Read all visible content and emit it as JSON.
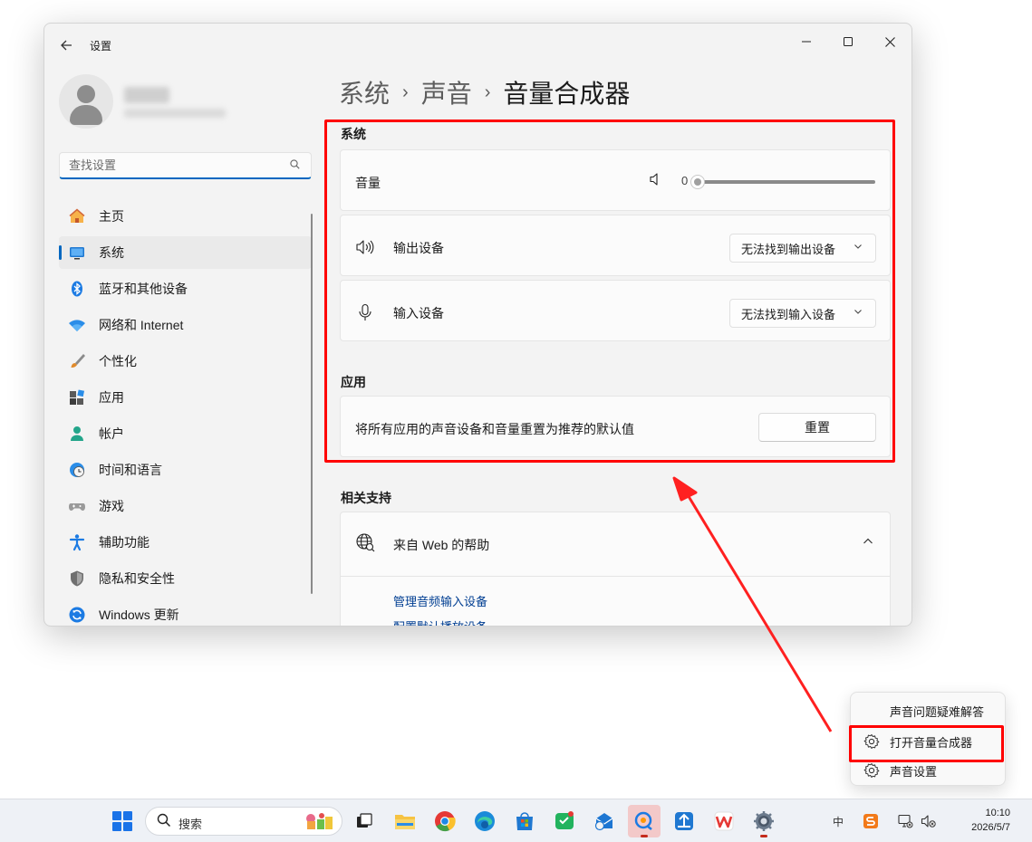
{
  "window": {
    "app_title": "设置",
    "controls": {
      "minimize": "—",
      "maximize": "☐",
      "close": "✕"
    }
  },
  "sidebar": {
    "search_placeholder": "查找设置",
    "items": [
      {
        "label": "主页",
        "icon": "home-icon"
      },
      {
        "label": "系统",
        "icon": "system-display-icon",
        "active": true
      },
      {
        "label": "蓝牙和其他设备",
        "icon": "bluetooth-icon"
      },
      {
        "label": "网络和 Internet",
        "icon": "wifi-icon"
      },
      {
        "label": "个性化",
        "icon": "brush-icon"
      },
      {
        "label": "应用",
        "icon": "apps-icon"
      },
      {
        "label": "帐户",
        "icon": "account-icon"
      },
      {
        "label": "时间和语言",
        "icon": "globe-clock-icon"
      },
      {
        "label": "游戏",
        "icon": "gamepad-icon"
      },
      {
        "label": "辅助功能",
        "icon": "accessibility-icon"
      },
      {
        "label": "隐私和安全性",
        "icon": "shield-icon"
      },
      {
        "label": "Windows 更新",
        "icon": "update-icon"
      }
    ]
  },
  "breadcrumb": {
    "items": [
      "系统",
      "声音"
    ],
    "current": "音量合成器",
    "separator": "›"
  },
  "system_section": {
    "heading": "系统",
    "volume": {
      "label": "音量",
      "value": "0",
      "level": 0
    },
    "output": {
      "label": "输出设备",
      "dropdown": "无法找到输出设备"
    },
    "input": {
      "label": "输入设备",
      "dropdown": "无法找到输入设备"
    }
  },
  "apps_section": {
    "heading": "应用",
    "reset_description": "将所有应用的声音设备和音量重置为推荐的默认值",
    "reset_button": "重置"
  },
  "support_section": {
    "heading": "相关支持",
    "help_title": "来自 Web 的帮助",
    "links": [
      "管理音频输入设备",
      "配置默认播放设备"
    ]
  },
  "context_menu": {
    "items": [
      {
        "label": "声音问题疑难解答"
      },
      {
        "label": "打开音量合成器",
        "icon": "gear-icon",
        "highlighted": true
      },
      {
        "label": "声音设置",
        "icon": "gear-icon"
      }
    ]
  },
  "taskbar": {
    "search_label": "搜索",
    "tray_ime": "中",
    "clock_time": "10:10",
    "clock_date": "2026/5/7"
  },
  "colors": {
    "accent": "#0067c0",
    "highlight": "#ff0000",
    "link": "#003e92"
  }
}
